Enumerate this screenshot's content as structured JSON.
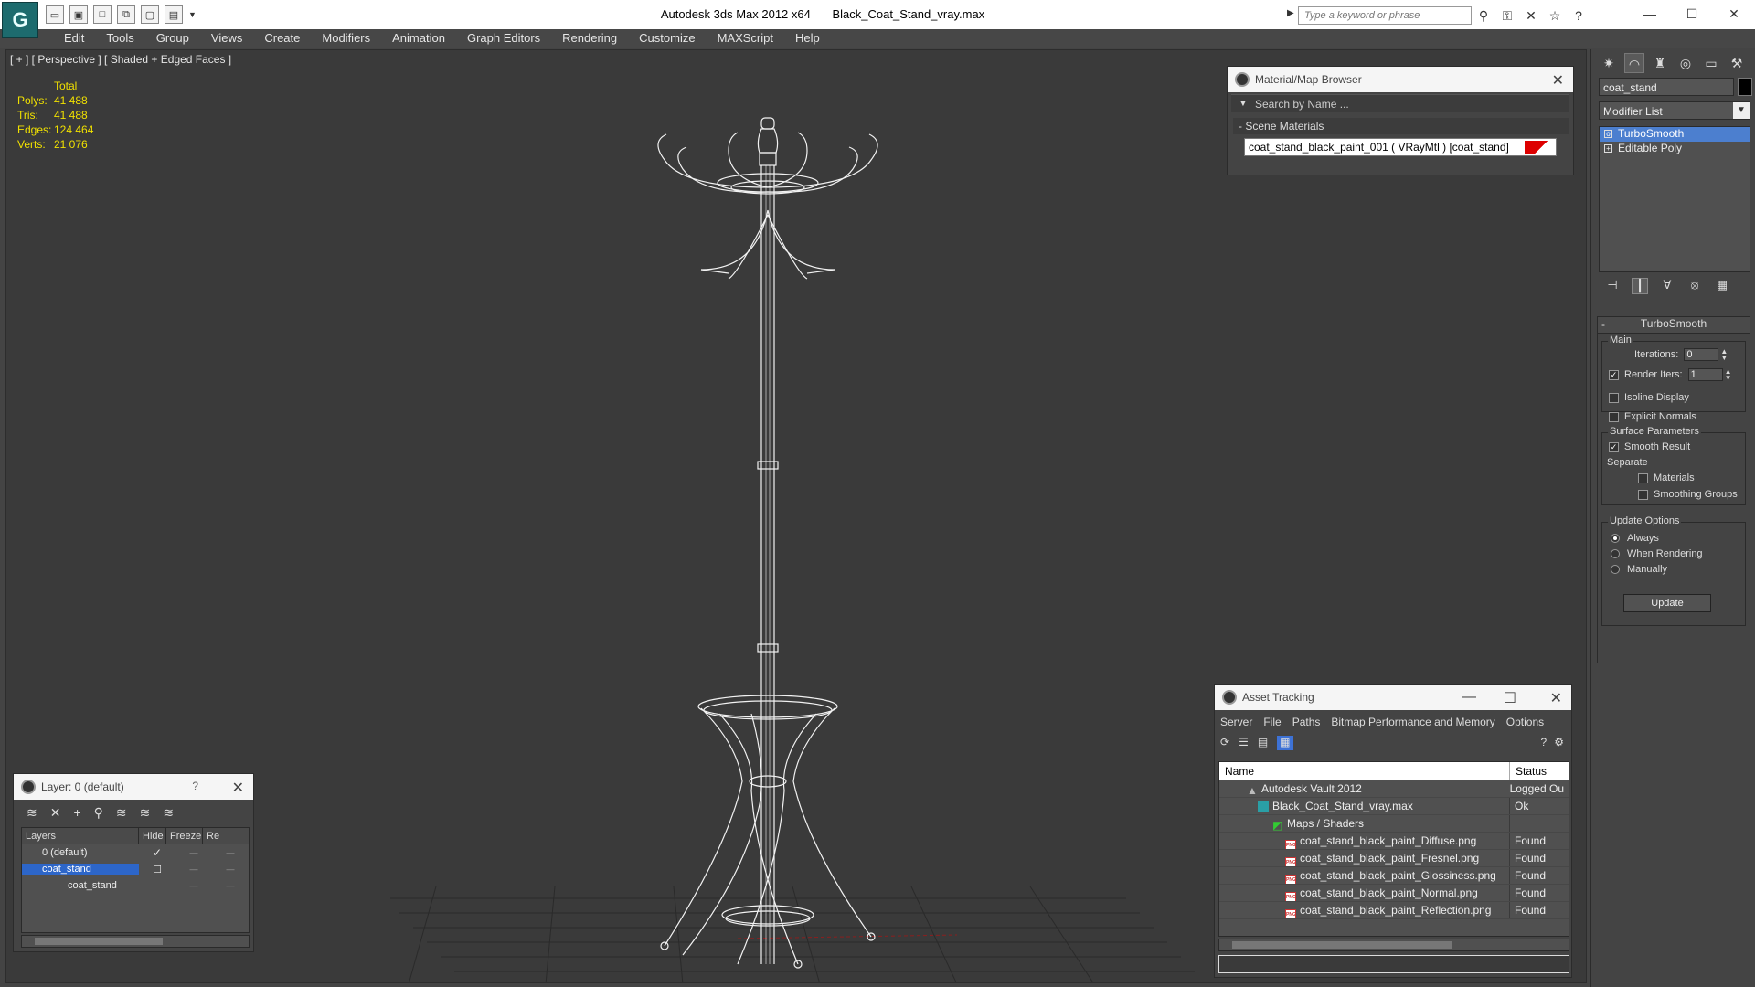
{
  "title": {
    "app": "Autodesk 3ds Max  2012 x64",
    "file": "Black_Coat_Stand_vray.max",
    "search_placeholder": "Type a keyword or phrase"
  },
  "menu": [
    "Edit",
    "Tools",
    "Group",
    "Views",
    "Create",
    "Modifiers",
    "Animation",
    "Graph Editors",
    "Rendering",
    "Customize",
    "MAXScript",
    "Help"
  ],
  "viewport": {
    "label": "[ + ] [ Perspective ] [ Shaded + Edged Faces ]",
    "stats_header": "Total",
    "stats": [
      {
        "k": "Polys:",
        "v": "41 488"
      },
      {
        "k": "Tris:",
        "v": "41 488"
      },
      {
        "k": "Edges:",
        "v": "124 464"
      },
      {
        "k": "Verts:",
        "v": "21 076"
      }
    ]
  },
  "material_browser": {
    "title": "Material/Map Browser",
    "search": "Search by Name ...",
    "section": "Scene Materials",
    "item": "coat_stand_black_paint_001  ( VRayMtl )  [coat_stand]"
  },
  "command_panel": {
    "object_name": "coat_stand",
    "modifier_list": "Modifier List",
    "stack": [
      "TurboSmooth",
      "Editable Poly"
    ],
    "rollout_title": "TurboSmooth",
    "main_group": "Main",
    "iterations_label": "Iterations:",
    "iterations_value": "0",
    "render_iters_label": "Render Iters:",
    "render_iters_value": "1",
    "isoline": "Isoline Display",
    "explicit": "Explicit Normals",
    "surface_group": "Surface Parameters",
    "smooth_result": "Smooth Result",
    "separate": "Separate",
    "materials": "Materials",
    "smoothing_groups": "Smoothing Groups",
    "update_group": "Update Options",
    "always": "Always",
    "when_rendering": "When Rendering",
    "manually": "Manually",
    "update_button": "Update"
  },
  "layers": {
    "title": "Layer: 0 (default)",
    "help": "?",
    "headers": [
      "Layers",
      "Hide",
      "Freeze",
      "Re"
    ],
    "rows": [
      {
        "name": "0 (default)"
      },
      {
        "name": "coat_stand"
      },
      {
        "name": "coat_stand"
      }
    ]
  },
  "asset_tracking": {
    "title": "Asset Tracking",
    "menu": [
      "Server",
      "File",
      "Paths",
      "Bitmap Performance and Memory",
      "Options"
    ],
    "headers": [
      "Name",
      "Status"
    ],
    "rows": [
      {
        "name": "Autodesk Vault 2012",
        "status": "Logged Ou"
      },
      {
        "name": "Black_Coat_Stand_vray.max",
        "status": "Ok"
      },
      {
        "name": "Maps / Shaders",
        "status": ""
      },
      {
        "name": "coat_stand_black_paint_Diffuse.png",
        "status": "Found"
      },
      {
        "name": "coat_stand_black_paint_Fresnel.png",
        "status": "Found"
      },
      {
        "name": "coat_stand_black_paint_Glossiness.png",
        "status": "Found"
      },
      {
        "name": "coat_stand_black_paint_Normal.png",
        "status": "Found"
      },
      {
        "name": "coat_stand_black_paint_Reflection.png",
        "status": "Found"
      }
    ]
  },
  "colors": {
    "stats": "#f0e000",
    "selection": "#4c7fcf",
    "material_swatch": "#dd0000"
  }
}
